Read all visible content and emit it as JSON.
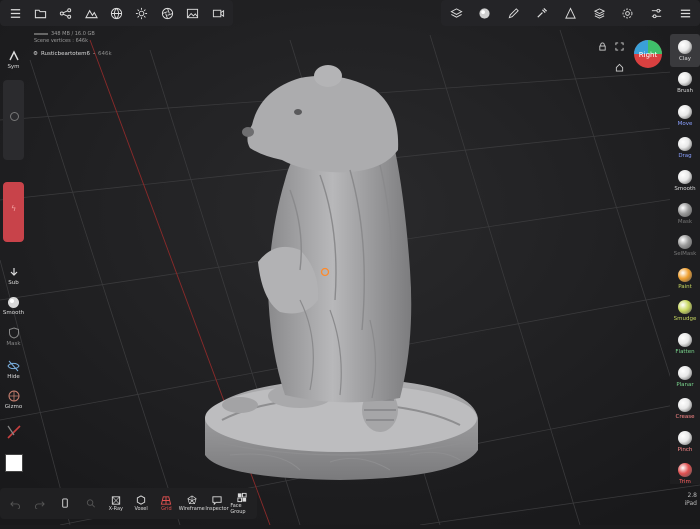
{
  "top_left_toolbar": {
    "icons": [
      "menu-icon",
      "folder-icon",
      "scene-graph-icon",
      "mountains-icon",
      "globe-icon",
      "sun-icon",
      "camera-shutter-icon",
      "image-icon",
      "video-icon"
    ]
  },
  "top_right_toolbar": {
    "icons": [
      "layers-stack-icon",
      "material-sphere-icon",
      "pen-icon",
      "eyedropper-icon",
      "cone-icon",
      "stack-icon",
      "gear-icon",
      "sliders-icon",
      "hamburger-icon"
    ]
  },
  "info": {
    "memory": "348 MB / 16.0 GB",
    "scene_vertices": "Scene vertices : 646k"
  },
  "scene": {
    "object_name": "Rusticbeartotem6",
    "object_vertices": "646k"
  },
  "gizmo": {
    "label": "Right"
  },
  "left_panel": {
    "sym_label": "Sym",
    "sub_label": "Sub",
    "smooth_label": "Smooth",
    "mask_label": "Mask",
    "hide_label": "Hide",
    "gizmo_label": "Gizmo"
  },
  "right_panel": {
    "tools": [
      {
        "label": "Clay",
        "color": "#e8e8e8"
      },
      {
        "label": "Brush",
        "color": "#e8e8e8"
      },
      {
        "label": "Move",
        "color": "#e8e8e8"
      },
      {
        "label": "Drag",
        "color": "#e8e8e8"
      },
      {
        "label": "Smooth",
        "color": "#e8e8e8"
      },
      {
        "label": "Mask",
        "color": "#9a9a9a"
      },
      {
        "label": "SelMask",
        "color": "#9a9a9a"
      },
      {
        "label": "Paint",
        "color": "#f0a030"
      },
      {
        "label": "Smudge",
        "color": "#c8d860"
      },
      {
        "label": "Flatten",
        "color": "#e8e8e8"
      },
      {
        "label": "Planar",
        "color": "#e8e8e8"
      },
      {
        "label": "Crease",
        "color": "#e8e8e8"
      },
      {
        "label": "Pinch",
        "color": "#e8e8e8"
      },
      {
        "label": "Trim",
        "color": "#e05050"
      }
    ],
    "label_colors": {
      "Clay": "#dddddd",
      "Brush": "#dddddd",
      "Move": "#8aa0ff",
      "Drag": "#8aa0ff",
      "Smooth": "#dddddd",
      "Mask": "#777777",
      "SelMask": "#777777",
      "Paint": "#c8d860",
      "Smudge": "#c8d860",
      "Flatten": "#7bd88f",
      "Planar": "#7bd88f",
      "Crease": "#ff8a8a",
      "Pinch": "#ff8a8a",
      "Trim": "#ff6060"
    }
  },
  "bottom_bar": {
    "items": [
      {
        "label": "",
        "icon": "undo-icon",
        "dim": true
      },
      {
        "label": "",
        "icon": "redo-icon",
        "dim": true
      },
      {
        "label": "",
        "icon": "phone-icon",
        "dim": false
      },
      {
        "label": "",
        "icon": "search-icon",
        "dim": true
      },
      {
        "label": "X-Ray",
        "icon": "xray-icon",
        "dim": false
      },
      {
        "label": "Voxel",
        "icon": "voxel-icon",
        "dim": false
      },
      {
        "label": "Grid",
        "icon": "grid-icon",
        "dim": false,
        "accent": "#e05050"
      },
      {
        "label": "Wireframe",
        "icon": "wireframe-icon",
        "dim": false
      },
      {
        "label": "Inspector",
        "icon": "inspector-icon",
        "dim": false
      },
      {
        "label": "Face Group",
        "icon": "face-group-icon",
        "dim": false
      }
    ]
  },
  "version": {
    "number": "2.8",
    "device": "iPad"
  }
}
